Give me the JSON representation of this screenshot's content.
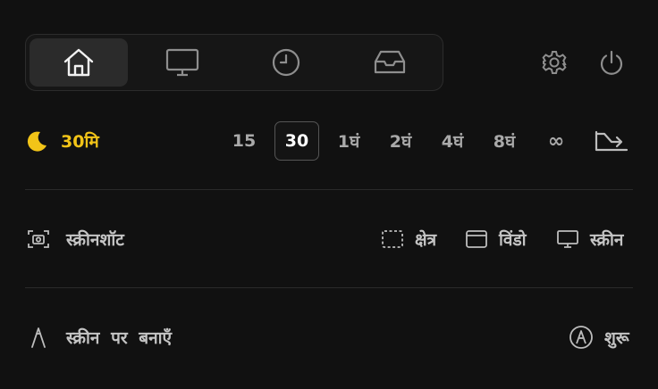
{
  "tabs": [
    {
      "name": "home",
      "icon": "home-icon",
      "active": true
    },
    {
      "name": "display",
      "icon": "monitor-icon",
      "active": false
    },
    {
      "name": "history",
      "icon": "clock-icon",
      "active": false
    },
    {
      "name": "inbox",
      "icon": "inbox-tray-icon",
      "active": false
    }
  ],
  "header": {
    "settings_icon": "gear-icon",
    "power_icon": "power-icon"
  },
  "timer": {
    "icon": "moon-icon",
    "label": "30मि",
    "options": [
      "15",
      "30",
      "1घं",
      "2घं",
      "4घं",
      "8घं",
      "∞"
    ],
    "selected": "30",
    "trailing_icon": "trend-down-arrow-icon"
  },
  "screenshot": {
    "title": "स्क्रीनशॉट",
    "options": [
      {
        "label": "क्षेत्र",
        "icon": "dashed-region-icon"
      },
      {
        "label": "विंडो",
        "icon": "window-icon"
      },
      {
        "label": "स्क्रीन",
        "icon": "monitor-icon"
      }
    ]
  },
  "draw": {
    "title": "स्क्रीन पर बनाएँ",
    "start_label": "शुरू",
    "start_icon": "pen-circle-icon"
  },
  "colors": {
    "accent": "#f2c418",
    "background": "#111111",
    "text": "#c4c4c4"
  }
}
